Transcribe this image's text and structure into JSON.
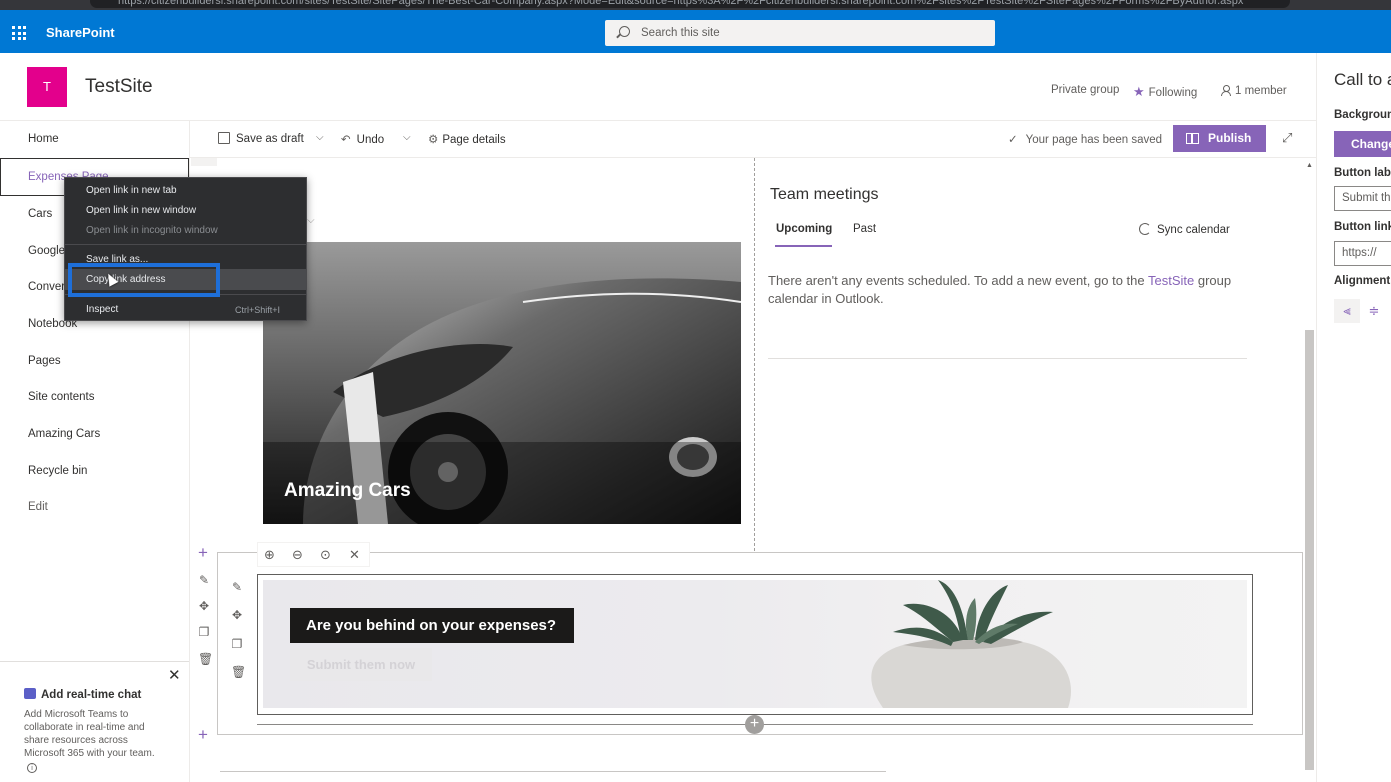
{
  "browser": {
    "url": "https://citizenbuildersl.sharepoint.com/sites/TestSite/SitePages/The-Best-Car-Company.aspx?Mode=Edit&source=https%3A%2F%2Fcitizenbuildersl.sharepoint.com%2Fsites%2FTestSite%2FSitePages%2FForms%2FByAuthor.aspx"
  },
  "suite": {
    "brand": "SharePoint",
    "search_placeholder": "Search this site"
  },
  "site": {
    "logo_letter": "T",
    "logo_color": "#e3008c",
    "title": "TestSite",
    "privacy": "Private group",
    "following": "Following",
    "members": "1 member"
  },
  "leftnav": {
    "items": [
      "Home",
      "Expenses Page",
      "Cars",
      "Google",
      "Conver",
      "Notebook",
      "Pages",
      "Site contents",
      "Amazing Cars",
      "Recycle bin",
      "Edit"
    ]
  },
  "commandbar": {
    "save_draft": "Save as draft",
    "undo": "Undo",
    "page_details": "Page details",
    "saved_status": "Your page has been saved",
    "publish": "Publish"
  },
  "hero": {
    "title": "Amazing Cars"
  },
  "events": {
    "title": "Team meetings",
    "tabs": [
      "Upcoming",
      "Past"
    ],
    "active_tab": "Upcoming",
    "sync": "Sync calendar",
    "empty_prefix": "There aren't any events scheduled. To add a new event, go to the ",
    "empty_link": "TestSite",
    "empty_suffix": " group calendar in Outlook."
  },
  "cta": {
    "headline": "Are you behind on your expenses?",
    "button": "Submit them now"
  },
  "property_pane": {
    "title": "Call to a",
    "background_label": "Background",
    "change_button": "Change",
    "button_label_label": "Button label",
    "button_label_value": "Submit th",
    "button_link_label": "Button link",
    "button_link_value": "https://",
    "alignment_label": "Alignment"
  },
  "teams_prompt": {
    "title": "Add real-time chat",
    "text": "Add Microsoft Teams to collaborate in real-time and share resources across Microsoft 365 with your team."
  },
  "context_menu": {
    "items": [
      {
        "label": "Open link in new tab",
        "disabled": false
      },
      {
        "label": "Open link in new window",
        "disabled": false
      },
      {
        "label": "Open link in incognito window",
        "disabled": true
      },
      {
        "label": "Save link as...",
        "disabled": false
      },
      {
        "label": "Copy link address",
        "disabled": false
      },
      {
        "label": "Inspect",
        "disabled": false
      }
    ],
    "inspect_shortcut": "Ctrl+Shift+I"
  },
  "colors": {
    "suite_blue": "#0078d4",
    "accent_purple": "#8764b8",
    "highlight_blue": "#1e6fd9"
  }
}
